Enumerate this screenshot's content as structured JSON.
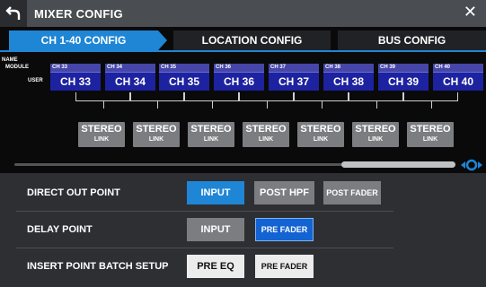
{
  "window": {
    "title": "MIXER CONFIG"
  },
  "tabs": [
    {
      "label": "CH 1-40 CONFIG",
      "active": true
    },
    {
      "label": "LOCATION CONFIG",
      "active": false
    },
    {
      "label": "BUS CONFIG",
      "active": false
    }
  ],
  "row_labels": {
    "name": "NAME",
    "module": "MODULE",
    "user": "USER"
  },
  "channels": [
    {
      "module": "CH 33",
      "user": "CH 33"
    },
    {
      "module": "CH 34",
      "user": "CH 34"
    },
    {
      "module": "CH 35",
      "user": "CH 35"
    },
    {
      "module": "CH 36",
      "user": "CH 36"
    },
    {
      "module": "CH 37",
      "user": "CH 37"
    },
    {
      "module": "CH 38",
      "user": "CH 38"
    },
    {
      "module": "CH 39",
      "user": "CH 39"
    },
    {
      "module": "CH 40",
      "user": "CH 40"
    }
  ],
  "stereo_link": {
    "line1": "STEREO",
    "line2": "LINK"
  },
  "settings": {
    "direct_out": {
      "label": "DIRECT OUT POINT",
      "options": [
        "INPUT",
        "POST HPF",
        "POST FADER"
      ]
    },
    "delay": {
      "label": "DELAY POINT",
      "options": [
        "INPUT",
        "PRE FADER"
      ]
    },
    "insert": {
      "label": "INSERT POINT BATCH SETUP",
      "options": [
        "PRE EQ",
        "PRE FADER"
      ]
    }
  },
  "colors": {
    "accent": "#1f86d6",
    "channel_user": "#1d22a0",
    "channel_module": "#4546a8",
    "button_gray": "#7b7d80"
  },
  "icons": {
    "back": "back-arrow-icon",
    "close": "close-icon",
    "scroll": "scroll-handle-icon"
  }
}
